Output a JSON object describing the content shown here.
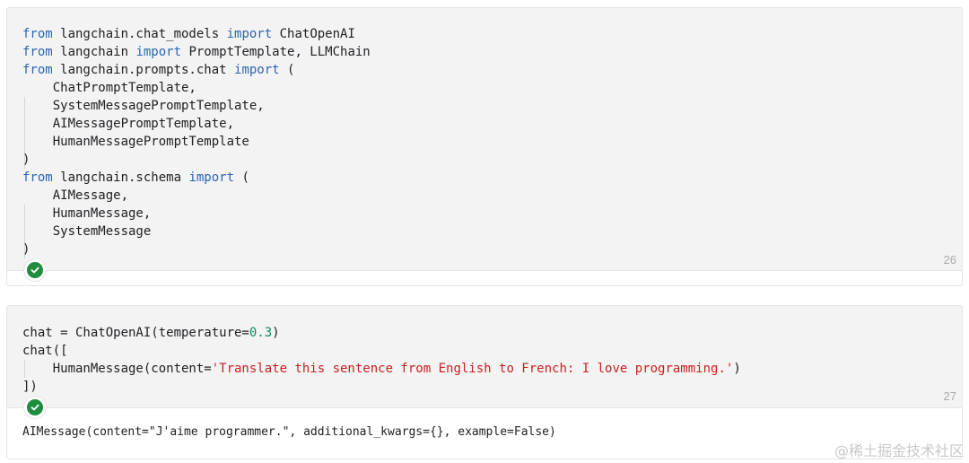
{
  "cells": [
    {
      "execution_count": "26",
      "status": "success",
      "code_lines": [
        [
          {
            "t": "from",
            "c": "kw"
          },
          {
            "t": " langchain.chat_models "
          },
          {
            "t": "import",
            "c": "kw"
          },
          {
            "t": " ChatOpenAI"
          }
        ],
        [
          {
            "t": "from",
            "c": "kw"
          },
          {
            "t": " langchain "
          },
          {
            "t": "import",
            "c": "kw"
          },
          {
            "t": " PromptTemplate, LLMChain"
          }
        ],
        [
          {
            "t": "from",
            "c": "kw"
          },
          {
            "t": " langchain.prompts.chat "
          },
          {
            "t": "import",
            "c": "kw"
          },
          {
            "t": " ("
          }
        ],
        [
          {
            "t": "    ChatPromptTemplate,"
          }
        ],
        [
          {
            "t": "    SystemMessagePromptTemplate,"
          }
        ],
        [
          {
            "t": "    AIMessagePromptTemplate,"
          }
        ],
        [
          {
            "t": "    HumanMessagePromptTemplate"
          }
        ],
        [
          {
            "t": ")"
          }
        ],
        [
          {
            "t": "from",
            "c": "kw"
          },
          {
            "t": " langchain.schema "
          },
          {
            "t": "import",
            "c": "kw"
          },
          {
            "t": " ("
          }
        ],
        [
          {
            "t": "    AIMessage,"
          }
        ],
        [
          {
            "t": "    HumanMessage,"
          }
        ],
        [
          {
            "t": "    SystemMessage"
          }
        ],
        [
          {
            "t": ")"
          }
        ]
      ]
    },
    {
      "execution_count": "27",
      "status": "success",
      "code_lines": [
        [
          {
            "t": "chat = ChatOpenAI(temperature="
          },
          {
            "t": "0.3",
            "c": "num"
          },
          {
            "t": ")"
          }
        ],
        [
          {
            "t": "chat(["
          }
        ],
        [
          {
            "t": "    HumanMessage(content="
          },
          {
            "t": "'Translate this sentence from English to French: I love programming.'",
            "c": "str"
          },
          {
            "t": ")"
          }
        ],
        [
          {
            "t": "])"
          }
        ]
      ],
      "output": "AIMessage(content=\"J'aime programmer.\", additional_kwargs={}, example=False)"
    }
  ],
  "watermark": "@稀土掘金技术社区",
  "colors": {
    "keyword": "#2b65b0",
    "number": "#0f8a5f",
    "string": "#c5221f",
    "success": "#1e8e3e"
  }
}
